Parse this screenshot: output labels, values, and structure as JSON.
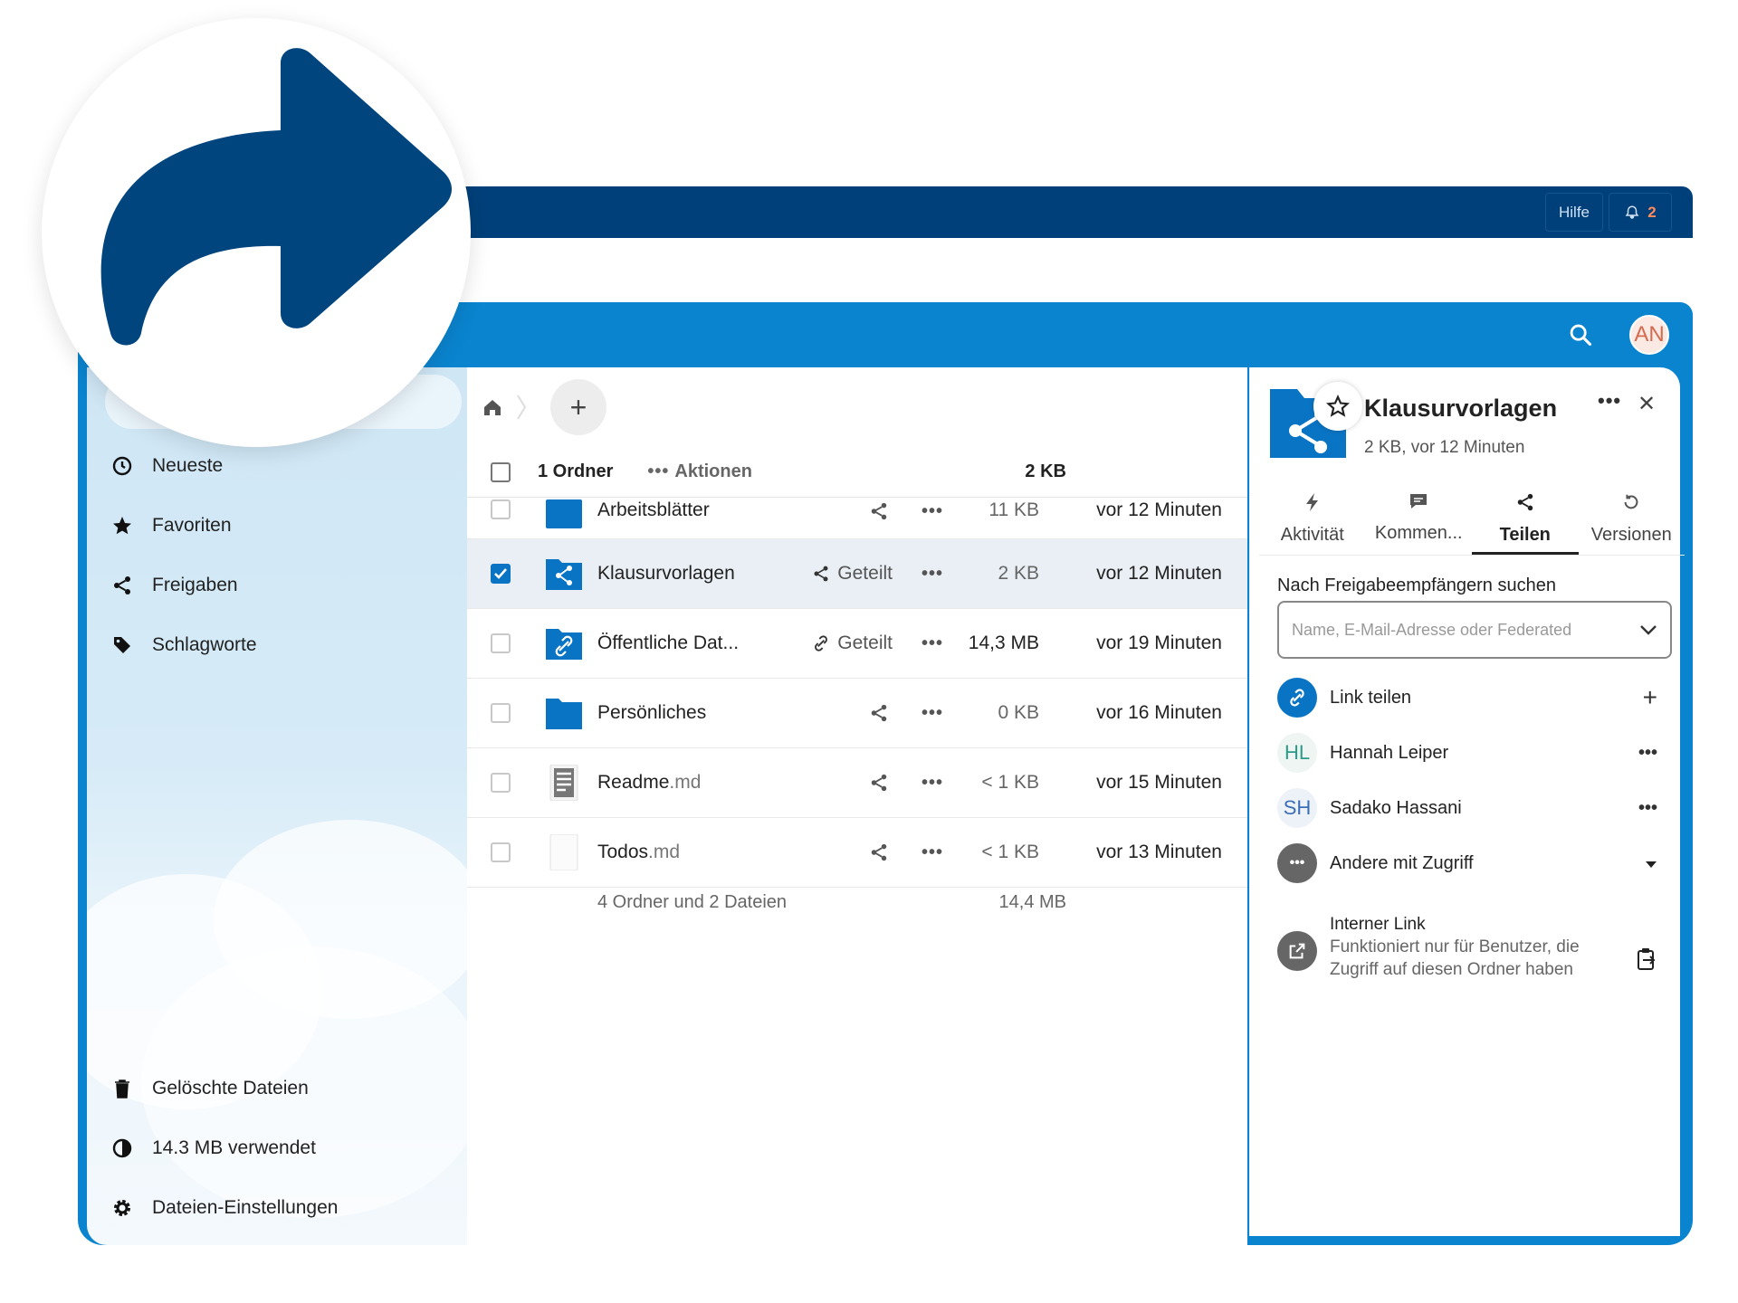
{
  "topbar": {
    "help": "Hilfe",
    "notification_count": "2"
  },
  "header": {
    "avatar": "AN"
  },
  "nav": {
    "items": [
      {
        "label": "Neueste",
        "icon": "clock-icon"
      },
      {
        "label": "Favoriten",
        "icon": "star-icon"
      },
      {
        "label": "Freigaben",
        "icon": "share-icon"
      },
      {
        "label": "Schlagworte",
        "icon": "tag-icon"
      }
    ],
    "bottom": [
      {
        "label": "Gelöschte Dateien",
        "icon": "trash-icon"
      },
      {
        "label": "14.3 MB verwendet",
        "icon": "quota-icon"
      },
      {
        "label": "Dateien-Einstellungen",
        "icon": "gear-icon"
      }
    ]
  },
  "files": {
    "head": {
      "selected": "1 Ordner",
      "actions": "Aktionen",
      "size": "2 KB"
    },
    "rows": [
      {
        "name": "Arbeitsblätter",
        "ext": "",
        "shared": "",
        "size": "11 KB",
        "modified": "vor 12 Minuten"
      },
      {
        "name": "Klausurvorlagen",
        "ext": "",
        "shared": "Geteilt",
        "size": "2 KB",
        "modified": "vor 12 Minuten"
      },
      {
        "name": "Öffentliche Dat...",
        "ext": "",
        "shared": "Geteilt",
        "size": "14,3 MB",
        "modified": "vor 19 Minuten"
      },
      {
        "name": "Persönliches",
        "ext": "",
        "shared": "",
        "size": "0 KB",
        "modified": "vor 16 Minuten"
      },
      {
        "name": "Readme",
        "ext": ".md",
        "shared": "",
        "size": "< 1 KB",
        "modified": "vor 15 Minuten"
      },
      {
        "name": "Todos",
        "ext": ".md",
        "shared": "",
        "size": "< 1 KB",
        "modified": "vor 13 Minuten"
      }
    ],
    "summary": {
      "count": "4 Ordner und 2 Dateien",
      "size": "14,4 MB"
    }
  },
  "sidebar": {
    "title": "Klausurvorlagen",
    "subtitle": "2 KB, vor 12 Minuten",
    "tabs": [
      "Aktivität",
      "Kommen...",
      "Teilen",
      "Versionen"
    ],
    "search_label": "Nach Freigabeempfängern suchen",
    "search_placeholder": "Name, E-Mail-Adresse oder Federated",
    "link_share": "Link teilen",
    "shares": [
      {
        "initials": "HL",
        "name": "Hannah Leiper"
      },
      {
        "initials": "SH",
        "name": "Sadako Hassani"
      }
    ],
    "others": "Andere mit Zugriff",
    "internal_link": {
      "title": "Interner Link",
      "desc": "Funktioniert nur für Benutzer, die Zugriff auf diesen Ordner haben"
    }
  },
  "colors": {
    "brand_dark": "#00407a",
    "brand": "#0a84cf",
    "folder": "#0a74c4"
  }
}
